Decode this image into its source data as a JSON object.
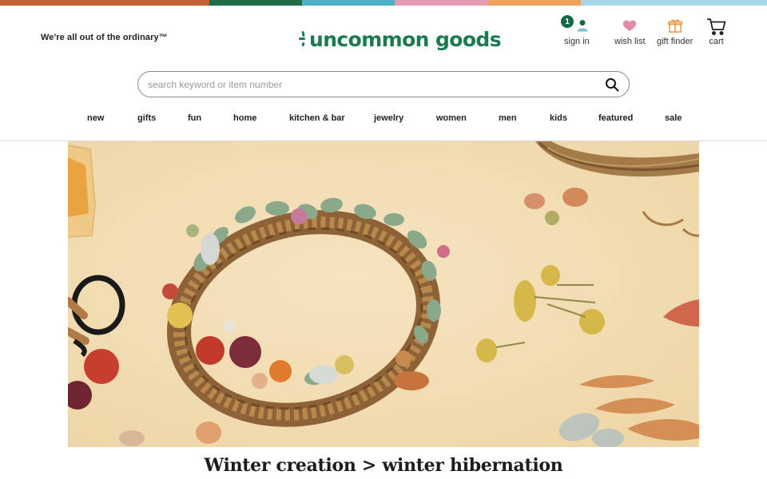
{
  "colors": {
    "brand_green": "#1b7a4f",
    "badge_green": "#116a43",
    "stripe": [
      "#c45f33",
      "#1f6b44",
      "#4cb0c9",
      "#e89cb3",
      "#f0a15e",
      "#a5d7e8"
    ]
  },
  "header": {
    "tagline": "We're all out of the ordinary™",
    "logo_text": "uncommon goods",
    "account": {
      "badge_count": "1",
      "label": "sign in",
      "icon": "person-icon"
    },
    "wishlist": {
      "label": "wish list",
      "icon": "heart-icon"
    },
    "giftfinder": {
      "label": "gift finder",
      "icon": "gift-icon"
    },
    "cart": {
      "label": "cart",
      "icon": "cart-icon"
    }
  },
  "search": {
    "placeholder": "search keyword or item number",
    "value": "",
    "icon": "search-icon"
  },
  "nav": {
    "items": [
      "new",
      "gifts",
      "fun",
      "home",
      "kitchen & bar",
      "jewelry",
      "women",
      "men",
      "kids",
      "featured",
      "sale"
    ]
  },
  "hero": {
    "image": "dried-flower-wreath-photo"
  },
  "headline": "Winter creation > winter hibernation"
}
